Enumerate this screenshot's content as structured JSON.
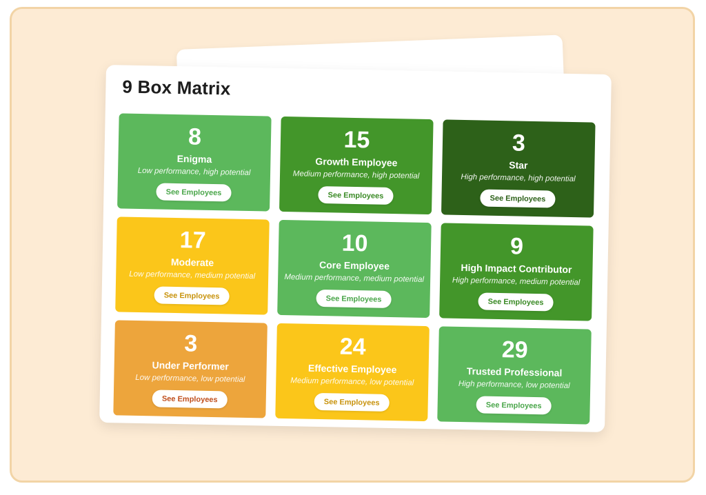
{
  "title": "9 Box Matrix",
  "colors": {
    "light_green": "#5cb85c",
    "medium_green": "#43962a",
    "dark_green": "#2d6119",
    "yellow": "#fbc61a",
    "orange": "#eda53c",
    "frame_bg": "#fdebd4",
    "frame_border": "#f2d4a6"
  },
  "boxes": [
    {
      "count": "8",
      "label": "Enigma",
      "description": "Low performance, high potential",
      "button": "See Employees",
      "color": "#5cb85c",
      "button_text_color": "#4aa64a"
    },
    {
      "count": "15",
      "label": "Growth Employee",
      "description": "Medium performance, high potential",
      "button": "See Employees",
      "color": "#43962a",
      "button_text_color": "#3a8a25"
    },
    {
      "count": "3",
      "label": "Star",
      "description": "High performance, high potential",
      "button": "See Employees",
      "color": "#2d6119",
      "button_text_color": "#2d6119"
    },
    {
      "count": "17",
      "label": "Moderate",
      "description": "Low performance, medium potential",
      "button": "See Employees",
      "color": "#fbc61a",
      "button_text_color": "#c8930d"
    },
    {
      "count": "10",
      "label": "Core Employee",
      "description": "Medium performance, medium potential",
      "button": "See Employees",
      "color": "#5cb85c",
      "button_text_color": "#4aa64a"
    },
    {
      "count": "9",
      "label": "High Impact Contributor",
      "description": "High performance, medium potential",
      "button": "See Employees",
      "color": "#43962a",
      "button_text_color": "#3a8a25"
    },
    {
      "count": "3",
      "label": "Under Performer",
      "description": "Low performance, low potential",
      "button": "See Employees",
      "color": "#eda53c",
      "button_text_color": "#c0501e"
    },
    {
      "count": "24",
      "label": "Effective Employee",
      "description": "Medium performance, low potential",
      "button": "See Employees",
      "color": "#fbc61a",
      "button_text_color": "#c8930d"
    },
    {
      "count": "29",
      "label": "Trusted Professional",
      "description": "High performance, low potential",
      "button": "See Employees",
      "color": "#5cb85c",
      "button_text_color": "#4aa64a"
    }
  ]
}
